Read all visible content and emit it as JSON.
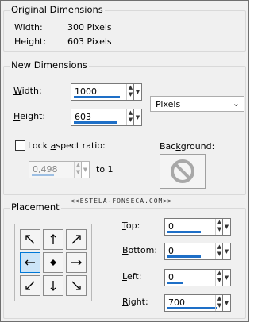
{
  "original": {
    "title": "Original Dimensions",
    "width_label": "Width:",
    "width_value": "300 Pixels",
    "height_label": "Height:",
    "height_value": "603 Pixels"
  },
  "new_dimensions": {
    "title": "New Dimensions",
    "width_label_u": "W",
    "width_label_rest": "idth:",
    "width_value": "1000",
    "height_label_u": "H",
    "height_label_rest": "eight:",
    "height_value": "603",
    "units": "Pixels",
    "lock_label_pre": "Lock ",
    "lock_label_u": "a",
    "lock_label_rest": "spect ratio:",
    "lock_checked": false,
    "ratio_value": "0,498",
    "ratio_suffix": "to 1",
    "background_label_pre": "Bac",
    "background_label_u": "k",
    "background_label_rest": "ground:"
  },
  "watermark": "<<ESTELA-FONSECA.COM>>",
  "placement": {
    "title": "Placement",
    "selected_anchor": "middle-left",
    "top_label_u": "T",
    "top_label_rest": "op:",
    "top_value": "0",
    "bottom_label_u": "B",
    "bottom_label_rest": "ottom:",
    "bottom_value": "0",
    "left_label_u": "L",
    "left_label_rest": "eft:",
    "left_value": "0",
    "right_label_u": "R",
    "right_label_rest": "ight:",
    "right_value": "700"
  },
  "icons": {
    "spin_up": "▲",
    "spin_down": "▼",
    "dropdown": "▼",
    "chevron": "⌄",
    "no_background": "⃠"
  }
}
